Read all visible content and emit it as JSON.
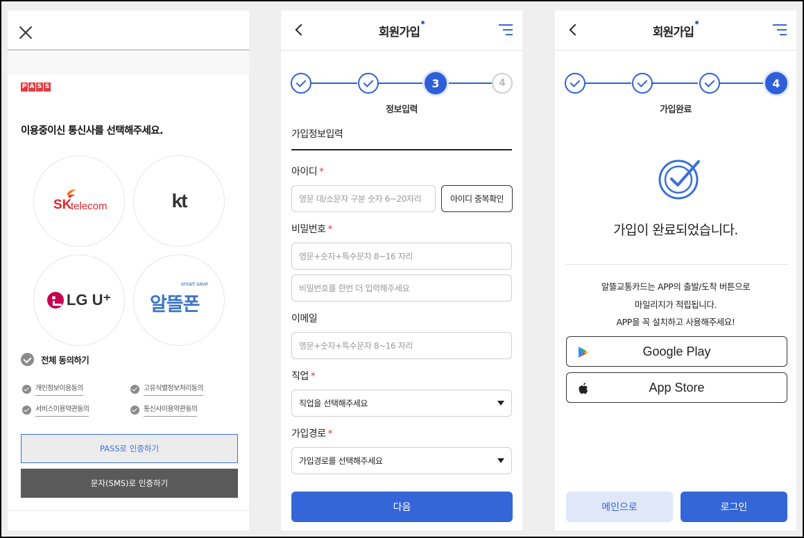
{
  "panel1": {
    "pass_logo": [
      "P",
      "A",
      "S",
      "S"
    ],
    "title": "이용중이신 통신사를 선택해주세요.",
    "carriers": {
      "skt": {
        "main": "SK",
        "sub": "telecom"
      },
      "kt": {
        "main": "kt"
      },
      "lgu": {
        "main": "LG U⁺"
      },
      "mvno": {
        "small": "smart save",
        "main": "알뜰폰"
      }
    },
    "agree_all": "전체 동의하기",
    "agreements": [
      "개인정보이용동의",
      "고유식별정보처리동의",
      "서비스이용약관동의",
      "통신사이용약관동의"
    ],
    "pass_button": "PASS로 인증하기",
    "sms_button": "문자(SMS)로 인증하기"
  },
  "panel2": {
    "header_title": "회원가입",
    "steps": [
      "",
      "",
      "3",
      "4"
    ],
    "step_label": "정보입력",
    "section_title": "가입정보입력",
    "id_label": "아이디",
    "id_placeholder": "영문 대/소문자 구분 숫자 6~20자리",
    "dup_check_button": "아이디 중복확인",
    "password_label": "비밀번호",
    "password_placeholder": "영문+숫자+특수문자 8~16 자리",
    "password_confirm_placeholder": "비밀번호를 한번 더 입력해주세요",
    "email_label": "이메일",
    "email_placeholder": "영문+숫자+특수문자 8~16 자리",
    "job_label": "직업",
    "job_value": "직업을 선택해주세요",
    "route_label": "가입경로",
    "route_value": "가입경로를 선택해주세요",
    "required_mark": "*",
    "next_button": "다음"
  },
  "panel3": {
    "header_title": "회원가입",
    "steps": [
      "",
      "",
      "",
      "4"
    ],
    "step_label": "가입완료",
    "complete_message": "가입이 완료되었습니다.",
    "info_lines": [
      "알뜰교통카드는 APP의 출발/도착 버튼으로",
      "마일리지가 적립됩니다.",
      "APP을 꼭 설치하고 사용해주세요!"
    ],
    "google_play": "Google Play",
    "app_store": "App Store",
    "main_button": "메인으로",
    "login_button": "로그인"
  },
  "colors": {
    "accent": "#3566d8",
    "pass_red": "#e53a40",
    "required_red": "#e23a3a",
    "skt_red": "#e4242a",
    "lgu_magenta": "#c7004f",
    "mvno_blue": "#3a76c6"
  }
}
